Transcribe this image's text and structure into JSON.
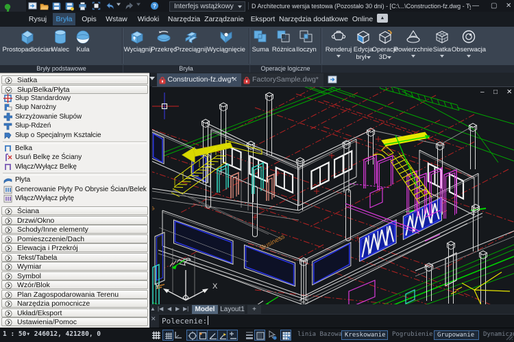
{
  "window": {
    "title": "D Architecture wersja testowa (Pozostało 30 dni)  - [C:\\...\\Construction-fz.dwg - Tylko do oc",
    "ui_mode_select": "Interfejs wstążkowy",
    "controls": {
      "minimize": "–",
      "maximize": "▢",
      "close": "✕"
    },
    "qat_icons": [
      "new-file",
      "open-folder",
      "save",
      "save-as",
      "print",
      "plot-preview",
      "undo",
      "undo-dropdown",
      "redo",
      "redo-dropdown",
      "help"
    ]
  },
  "ribbon": {
    "tabs": [
      {
        "label": "Rysuj",
        "active": false
      },
      {
        "label": "Bryła",
        "active": true
      },
      {
        "label": "Opis",
        "active": false
      },
      {
        "label": "Wstaw",
        "active": false
      },
      {
        "label": "Widoki",
        "active": false
      },
      {
        "label": "Narzędzia",
        "active": false
      },
      {
        "label": "Zarządzanie",
        "active": false
      },
      {
        "label": "Eksport",
        "active": false
      },
      {
        "label": "Narzędzia dodatkowe",
        "active": false
      },
      {
        "label": "Online",
        "active": false
      }
    ],
    "groups": [
      {
        "label": "Bryły podstawowe",
        "buttons": [
          "Prostopadłościan",
          "Walec",
          "Kula"
        ]
      },
      {
        "label": "Bryła",
        "buttons": [
          "Wyciągnij",
          "Przekręć",
          "Przeciągnij",
          "Wyciągnięcie"
        ]
      },
      {
        "label": "Operacje logiczne",
        "buttons": [
          "Suma",
          "Różnica",
          "Iloczyn"
        ]
      }
    ],
    "loose_buttons": [
      {
        "label": "Renderuj",
        "dropdown": true
      },
      {
        "label": "Edycja brył",
        "dropdown": true
      },
      {
        "label": "Operacje 3D",
        "dropdown": true
      },
      {
        "label": "Powierzchnie",
        "dropdown": true
      },
      {
        "label": "Siatka",
        "dropdown": true
      },
      {
        "label": "Obserwacja",
        "dropdown": true
      }
    ]
  },
  "palette": {
    "rows": [
      {
        "type": "header",
        "label": "Siatka",
        "expanded": false
      },
      {
        "type": "header",
        "label": "Słup/Belka/Płyta",
        "expanded": true
      },
      {
        "type": "item",
        "icon": "column-standard",
        "label": "Słup Standardowy"
      },
      {
        "type": "item",
        "icon": "column-corner",
        "label": "Słup Narożny"
      },
      {
        "type": "item",
        "icon": "column-cross",
        "label": "Skrzyżowanie Słupów"
      },
      {
        "type": "item",
        "icon": "column-core",
        "label": "Słup-Rdzeń"
      },
      {
        "type": "item",
        "icon": "column-special",
        "label": "Słup o Specjalnym Kształcie"
      },
      {
        "type": "sep"
      },
      {
        "type": "item",
        "icon": "beam",
        "label": "Belka"
      },
      {
        "type": "item",
        "icon": "beam-delete",
        "label": "Usuń Belkę ze Ściany"
      },
      {
        "type": "item",
        "icon": "beam-toggle",
        "label": "Włącz/Wyłącz Belkę"
      },
      {
        "type": "sep"
      },
      {
        "type": "item",
        "icon": "slab",
        "label": "Płyta"
      },
      {
        "type": "item",
        "icon": "slab-generate",
        "label": "Generowanie Płyty Po Obrysie Ścian/Belek"
      },
      {
        "type": "item",
        "icon": "slab-toggle",
        "label": "Włącz/Wyłącz płytę"
      },
      {
        "type": "gap"
      },
      {
        "type": "header",
        "label": "Ściana",
        "expanded": false
      },
      {
        "type": "header",
        "label": "Drzwi/Okno",
        "expanded": false
      },
      {
        "type": "header",
        "label": "Schody/Inne elementy",
        "expanded": false
      },
      {
        "type": "header",
        "label": "Pomieszczenie/Dach",
        "expanded": false
      },
      {
        "type": "header",
        "label": "Elewacja i Przekrój",
        "expanded": false
      },
      {
        "type": "header",
        "label": "Tekst/Tabela",
        "expanded": false
      },
      {
        "type": "header",
        "label": "Wymiar",
        "expanded": false
      },
      {
        "type": "header",
        "label": "Symbol",
        "expanded": false
      },
      {
        "type": "header",
        "label": "Wzór/Blok",
        "expanded": false
      },
      {
        "type": "header",
        "label": "Plan Zagospodarowania Terenu",
        "expanded": false
      },
      {
        "type": "header",
        "label": "Narzędzia pomocnicze",
        "expanded": false
      },
      {
        "type": "header",
        "label": "Układ/Eksport",
        "expanded": false
      },
      {
        "type": "header",
        "label": "Ustawienia/Pomoc",
        "expanded": false
      }
    ]
  },
  "documents": {
    "tabs": [
      {
        "label": "Construction-fz.dwg*",
        "active": true,
        "locked": true,
        "closable": true
      },
      {
        "label": "FactorySample.dwg*",
        "active": false,
        "locked": true,
        "closable": false
      }
    ]
  },
  "viewport": {
    "controls": {
      "minimize": "–",
      "restore": "□",
      "close": "✕"
    },
    "ucs": {
      "x_label": "X",
      "y_label": "Y"
    },
    "annotations": {
      "business_text": "Business"
    }
  },
  "layout_tabs": {
    "tabs": [
      {
        "label": "Model",
        "active": true
      },
      {
        "label": "Layout1",
        "active": false
      }
    ],
    "add_label": "+"
  },
  "command": {
    "prompt": "Polecenie:"
  },
  "statusbar": {
    "scale": "1 : 50",
    "coordinates": "246012, 421280, 0",
    "toggles": [
      {
        "label": "linia Bazowa",
        "active": false
      },
      {
        "label": "Kreskowanie",
        "active": true
      },
      {
        "label": "Pogrubienie",
        "active": false
      },
      {
        "label": "Grupowanie",
        "active": true
      },
      {
        "label": "Dynamiczne oznak",
        "active": false
      }
    ],
    "icons": [
      {
        "name": "grid-icon",
        "active": false
      },
      {
        "name": "snap-grid-icon",
        "active": true
      },
      {
        "name": "ortho-icon",
        "active": false
      },
      {
        "name": "osnap-icon",
        "active": true
      },
      {
        "name": "object-snap-icon",
        "active": true
      },
      {
        "name": "polar-icon",
        "active": true
      },
      {
        "name": "otrack-icon",
        "active": true
      },
      {
        "name": "dynamic-ucs-icon",
        "active": true
      },
      {
        "name": "lineweight-icon",
        "active": false
      },
      {
        "name": "transparency-icon",
        "active": true
      },
      {
        "name": "cursor-badge-icon",
        "active": false
      },
      {
        "name": "table-icon",
        "active": true
      }
    ]
  },
  "colors": {
    "accent_blue": "#4aa8ee",
    "icon_blue": "#63aee2",
    "cad_red": "#cc2222",
    "cad_green": "#00b400",
    "cad_yellow": "#e8e800",
    "cad_cyan": "#2fe0c8",
    "cad_magenta": "#e03ae0",
    "cad_orange": "#c07828",
    "cad_window_blue": "#2a35e0"
  }
}
